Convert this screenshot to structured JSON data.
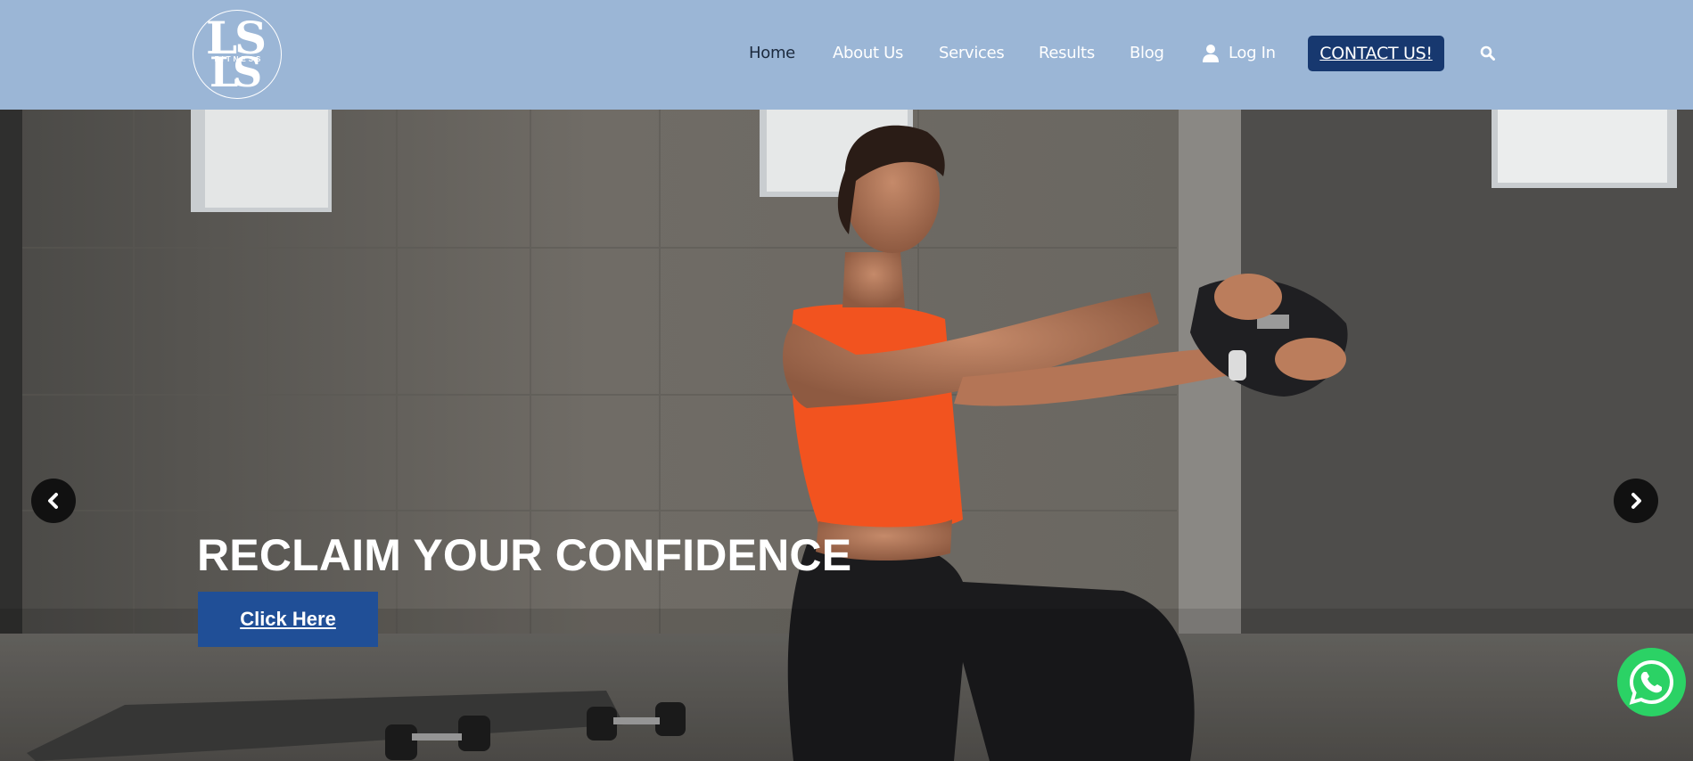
{
  "brand": {
    "logo_letters_1": "LS",
    "logo_letters_2": "LS",
    "logo_tagline": "FITNESS",
    "logo_icon": "ls-fitness-logo"
  },
  "nav": {
    "home": "Home",
    "about": "About Us",
    "services": "Services",
    "results": "Results",
    "blog": "Blog",
    "login": "Log In",
    "contact": "CONTACT US!",
    "login_icon": "user-icon",
    "search_icon": "search-icon"
  },
  "hero": {
    "title": "RECLAIM YOUR CONFIDENCE",
    "button": "Click Here",
    "prev_icon": "chevron-left-icon",
    "next_icon": "chevron-right-icon"
  },
  "floating": {
    "whatsapp_icon": "whatsapp-icon"
  },
  "colors": {
    "header_bg": "#9bb6d6",
    "contact_button": "#17386f",
    "hero_button": "#204f97",
    "whatsapp": "#2bd265",
    "top_accent": "#ff5a1f"
  }
}
